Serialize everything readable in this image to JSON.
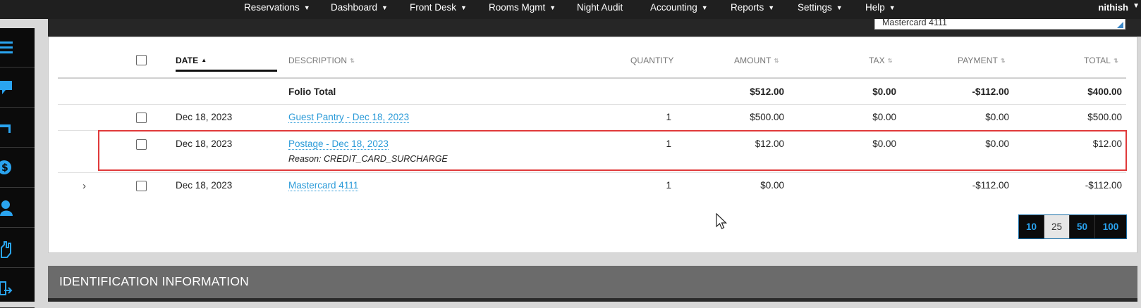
{
  "nav": {
    "items": [
      {
        "label": "Reservations",
        "caret": true
      },
      {
        "label": "Dashboard",
        "caret": true
      },
      {
        "label": "Front Desk",
        "caret": true
      },
      {
        "label": "Rooms Mgmt",
        "caret": true
      },
      {
        "label": "Night Audit",
        "caret": false
      },
      {
        "label": "Accounting",
        "caret": true
      },
      {
        "label": "Reports",
        "caret": true
      },
      {
        "label": "Settings",
        "caret": true
      },
      {
        "label": "Help",
        "caret": true
      }
    ],
    "user": "nithish"
  },
  "payment_select": {
    "value": "Mastercard 4111"
  },
  "sidebar": {
    "icons": [
      "list-icon",
      "chat-icon",
      "bed-icon",
      "dollar-icon",
      "user-icon",
      "hand-icon",
      "transfer-icon"
    ]
  },
  "table": {
    "headers": {
      "date": "DATE",
      "description": "DESCRIPTION",
      "quantity": "QUANTITY",
      "amount": "AMOUNT",
      "tax": "TAX",
      "payment": "PAYMENT",
      "total": "TOTAL"
    },
    "folio_total": {
      "label": "Folio Total",
      "amount": "$512.00",
      "tax": "$0.00",
      "payment": "-$112.00",
      "total": "$400.00"
    },
    "rows": [
      {
        "date": "Dec 18, 2023",
        "description": "Guest Pantry - Dec 18, 2023",
        "reason": "",
        "quantity": "1",
        "amount": "$500.00",
        "tax": "$0.00",
        "payment": "$0.00",
        "total": "$500.00"
      },
      {
        "date": "Dec 18, 2023",
        "description": "Postage - Dec 18, 2023",
        "reason": "Reason: CREDIT_CARD_SURCHARGE",
        "quantity": "1",
        "amount": "$12.00",
        "tax": "$0.00",
        "payment": "$0.00",
        "total": "$12.00"
      },
      {
        "date": "Dec 18, 2023",
        "description": "Mastercard 4111",
        "reason": "",
        "quantity": "1",
        "amount": "$0.00",
        "tax": "",
        "payment": "-$112.00",
        "total": "-$112.00"
      }
    ]
  },
  "pagination": {
    "options": [
      "10",
      "25",
      "50",
      "100"
    ],
    "selected": "25"
  },
  "section": {
    "identification_title": "IDENTIFICATION INFORMATION"
  },
  "colors": {
    "link": "#2a9ad8",
    "highlight_border": "#e0393a",
    "nav_bg": "#1f1f1f",
    "pager_text": "#2aa4f0"
  }
}
